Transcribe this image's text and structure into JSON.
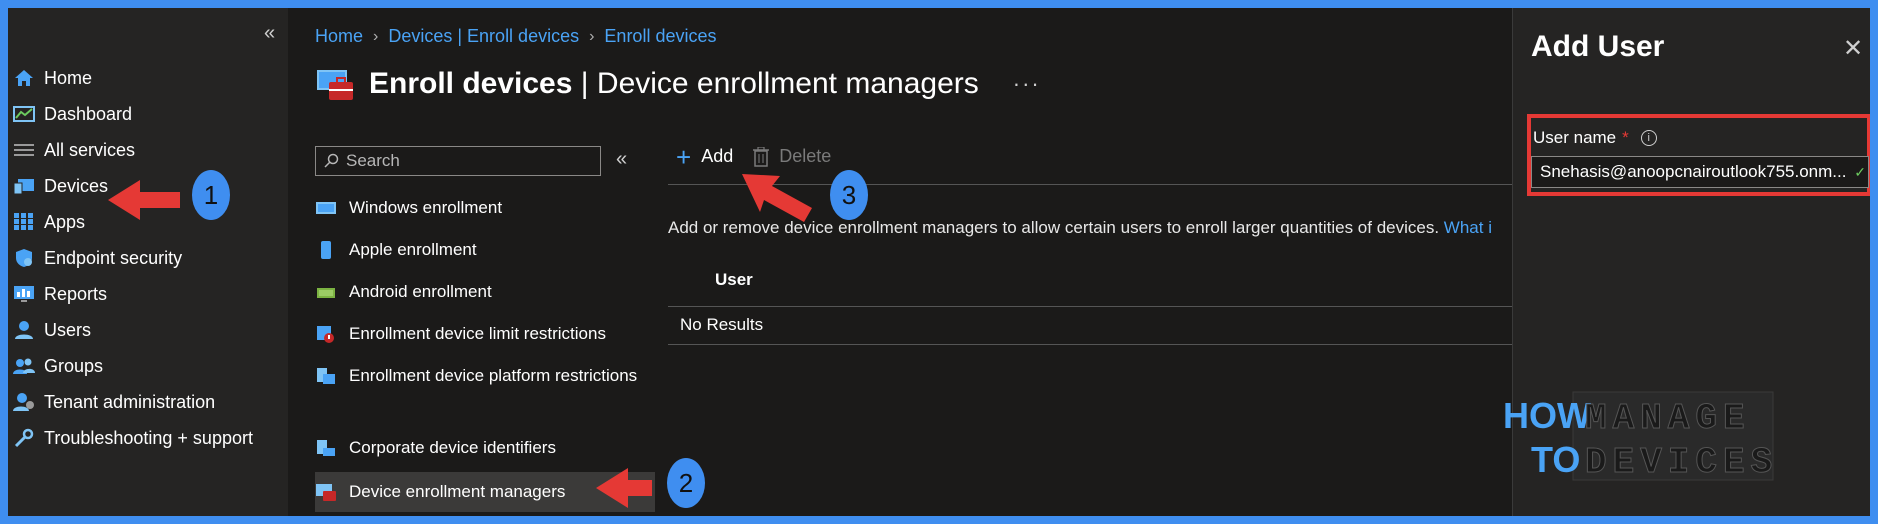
{
  "nav": {
    "collapse_icon": "«",
    "items": [
      {
        "label": "Home",
        "icon": "home-icon"
      },
      {
        "label": "Dashboard",
        "icon": "dashboard-icon"
      },
      {
        "label": "All services",
        "icon": "list-icon"
      },
      {
        "label": "Devices",
        "icon": "devices-icon"
      },
      {
        "label": "Apps",
        "icon": "apps-icon"
      },
      {
        "label": "Endpoint security",
        "icon": "shield-icon"
      },
      {
        "label": "Reports",
        "icon": "reports-icon"
      },
      {
        "label": "Users",
        "icon": "user-icon"
      },
      {
        "label": "Groups",
        "icon": "groups-icon"
      },
      {
        "label": "Tenant administration",
        "icon": "tenant-icon"
      },
      {
        "label": "Troubleshooting + support",
        "icon": "wrench-icon"
      }
    ]
  },
  "breadcrumb": [
    "Home",
    "Devices | Enroll devices",
    "Enroll devices"
  ],
  "page": {
    "title_bold": "Enroll devices",
    "title_rest": " | Device enrollment managers",
    "more": "···"
  },
  "subnav": {
    "search_placeholder": "Search",
    "collapse_icon": "«",
    "items": [
      "Windows enrollment",
      "Apple enrollment",
      "Android enrollment",
      "Enrollment device limit restrictions",
      "Enrollment device platform restrictions",
      "Corporate device identifiers",
      "Device enrollment managers"
    ]
  },
  "toolbar": {
    "add": "Add",
    "delete": "Delete"
  },
  "main": {
    "description": "Add or remove device enrollment managers to allow certain users to enroll larger quantities of devices.",
    "description_link": "What i",
    "column_user": "User",
    "no_results": "No Results"
  },
  "panel": {
    "title": "Add User",
    "close": "✕",
    "field_label": "User name",
    "required": "*",
    "field_value": "Snehasis@anoopcnairoutlook755.onm...",
    "check": "✓"
  },
  "annotations": {
    "step1": "1",
    "step2": "2",
    "step3": "3"
  },
  "logo": {
    "line1a": "HOW",
    "line1b": "MANAGE",
    "line2a": "TO",
    "line2b": "DEVICES"
  },
  "colors": {
    "accent": "#4aa3f5",
    "annotation": "#e53935",
    "frame": "#3f8ef0"
  }
}
